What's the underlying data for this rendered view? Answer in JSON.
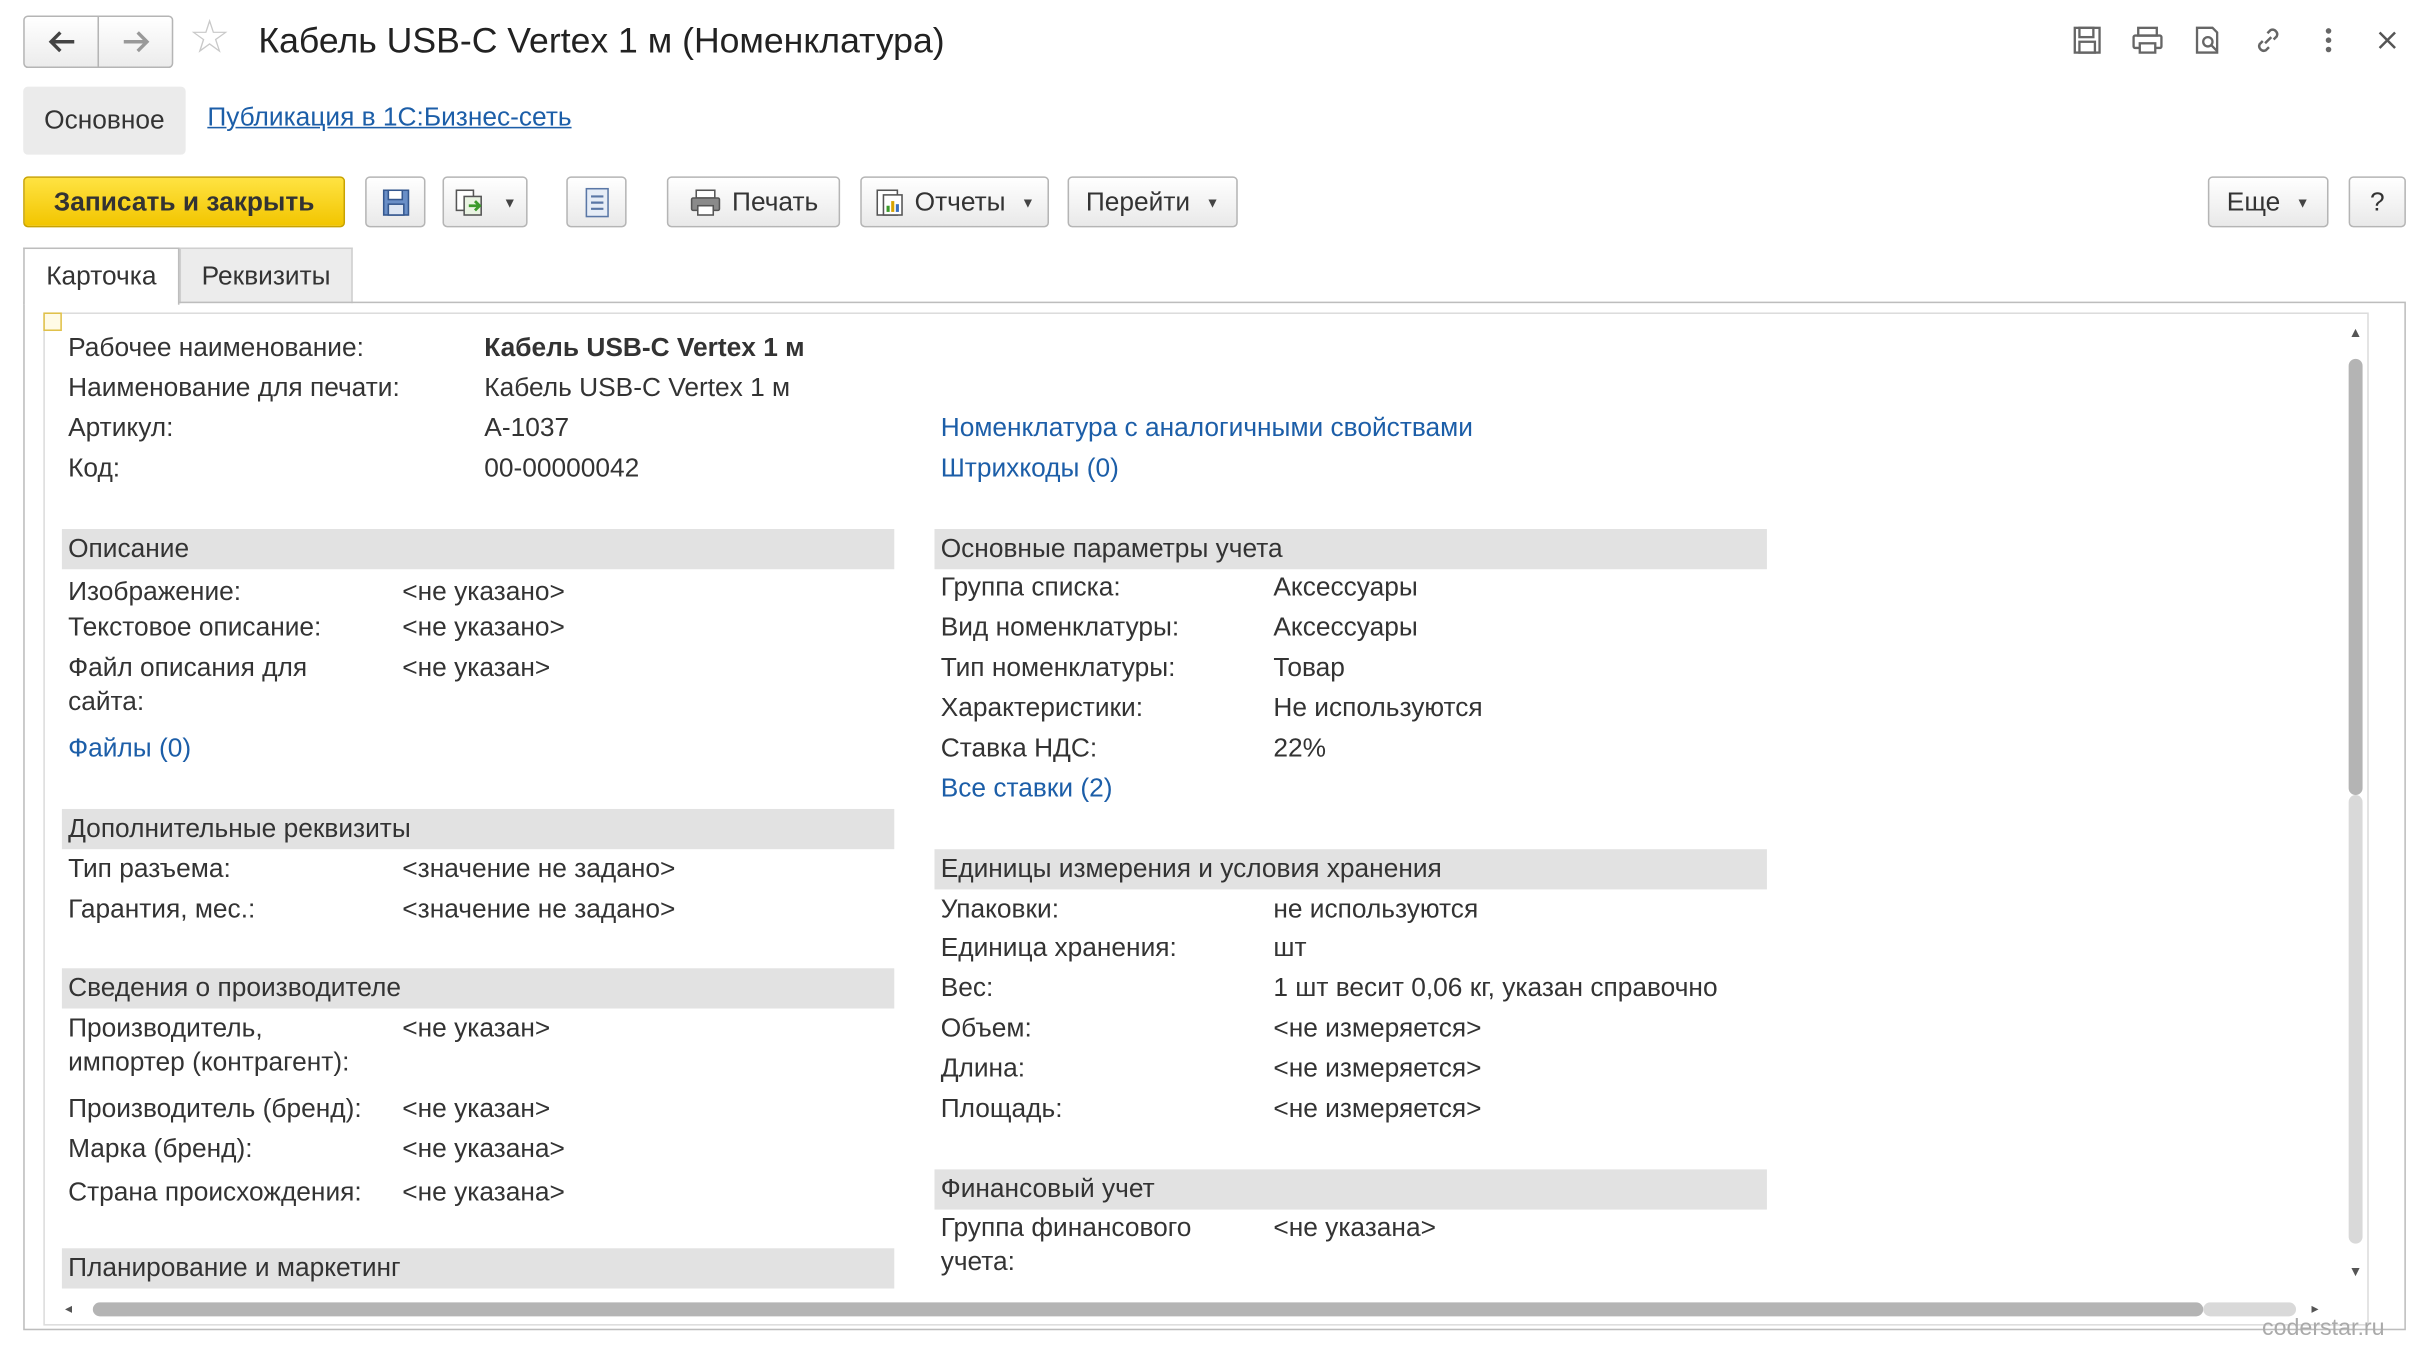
{
  "window": {
    "title": "Кабель USB-C Vertex 1 м (Номенклатура)"
  },
  "subtabs": {
    "main": "Основное",
    "publication": "Публикация в 1С:Бизнес-сеть"
  },
  "toolbar": {
    "save_close": "Записать и закрыть",
    "print": "Печать",
    "reports": "Отчеты",
    "goto": "Перейти",
    "more": "Еще",
    "help": "?"
  },
  "tabs": {
    "card": "Карточка",
    "props": "Реквизиты"
  },
  "header_fields": {
    "work_name_label": "Рабочее наименование:",
    "work_name_value": "Кабель USB-C Vertex 1 м",
    "print_name_label": "Наименование для печати:",
    "print_name_value": "Кабель USB-C Vertex 1 м",
    "article_label": "Артикул:",
    "article_value": "А-1037",
    "code_label": "Код:",
    "code_value": "00-00000042",
    "similar_link": "Номенклатура с аналогичными свойствами",
    "barcodes_link": "Штрихкоды (0)"
  },
  "description": {
    "title": "Описание",
    "image_label": "Изображение:",
    "image_value": "<не указано>",
    "text_label": "Текстовое описание:",
    "text_value": "<не указано>",
    "file_label_1": "Файл описания для",
    "file_label_2": "сайта:",
    "file_value": "<не указан>",
    "files_link": "Файлы (0)"
  },
  "additional": {
    "title": "Дополнительные реквизиты",
    "connector_label": "Тип разъема:",
    "connector_value": "<значение не задано>",
    "warranty_label": "Гарантия, мес.:",
    "warranty_value": "<значение не задано>"
  },
  "manufacturer": {
    "title": "Сведения о производителе",
    "importer_label_1": "Производитель,",
    "importer_label_2": "импортер (контрагент):",
    "importer_value": "<не указан>",
    "brand_label": "Производитель (бренд):",
    "brand_value": "<не указан>",
    "mark_label": "Марка (бренд):",
    "mark_value": "<не указана>",
    "country_label": "Страна происхождения:",
    "country_value": "<не указана>"
  },
  "planning": {
    "title": "Планирование и маркетинг"
  },
  "accounting": {
    "title": "Основные параметры учета",
    "group_label": "Группа списка:",
    "group_value": "Аксессуары",
    "kind_label": "Вид номенклатуры:",
    "kind_value": "Аксессуары",
    "type_label": "Тип номенклатуры:",
    "type_value": "Товар",
    "chars_label": "Характеристики:",
    "chars_value": "Не используются",
    "vat_label": "Ставка НДС:",
    "vat_value": "22%",
    "all_rates_link": "Все ставки (2)"
  },
  "units": {
    "title": "Единицы измерения и условия хранения",
    "packs_label": "Упаковки:",
    "packs_value": "не используются",
    "unit_label": "Единица хранения:",
    "unit_value": "шт",
    "weight_label": "Вес:",
    "weight_value": "1 шт весит 0,06 кг, указан справочно",
    "volume_label": "Объем:",
    "volume_value": "<не измеряется>",
    "length_label": "Длина:",
    "length_value": "<не измеряется>",
    "area_label": "Площадь:",
    "area_value": "<не измеряется>"
  },
  "finance": {
    "title": "Финансовый учет",
    "group_label_1": "Группа финансового",
    "group_label_2": "учета:",
    "group_value": "<не указана>"
  },
  "watermark": "coderstar.ru",
  "icons": [
    "arrow-left-icon",
    "arrow-right-icon",
    "star-icon",
    "floppy-icon",
    "printer-icon",
    "preview-icon",
    "link-icon",
    "more-vert-icon",
    "close-icon",
    "save-icon",
    "copy-icon",
    "list-icon",
    "report-icon"
  ],
  "colors": {
    "accent": "#f2c500",
    "link": "#1c5ea8",
    "section_bg": "#e2e2e2"
  }
}
